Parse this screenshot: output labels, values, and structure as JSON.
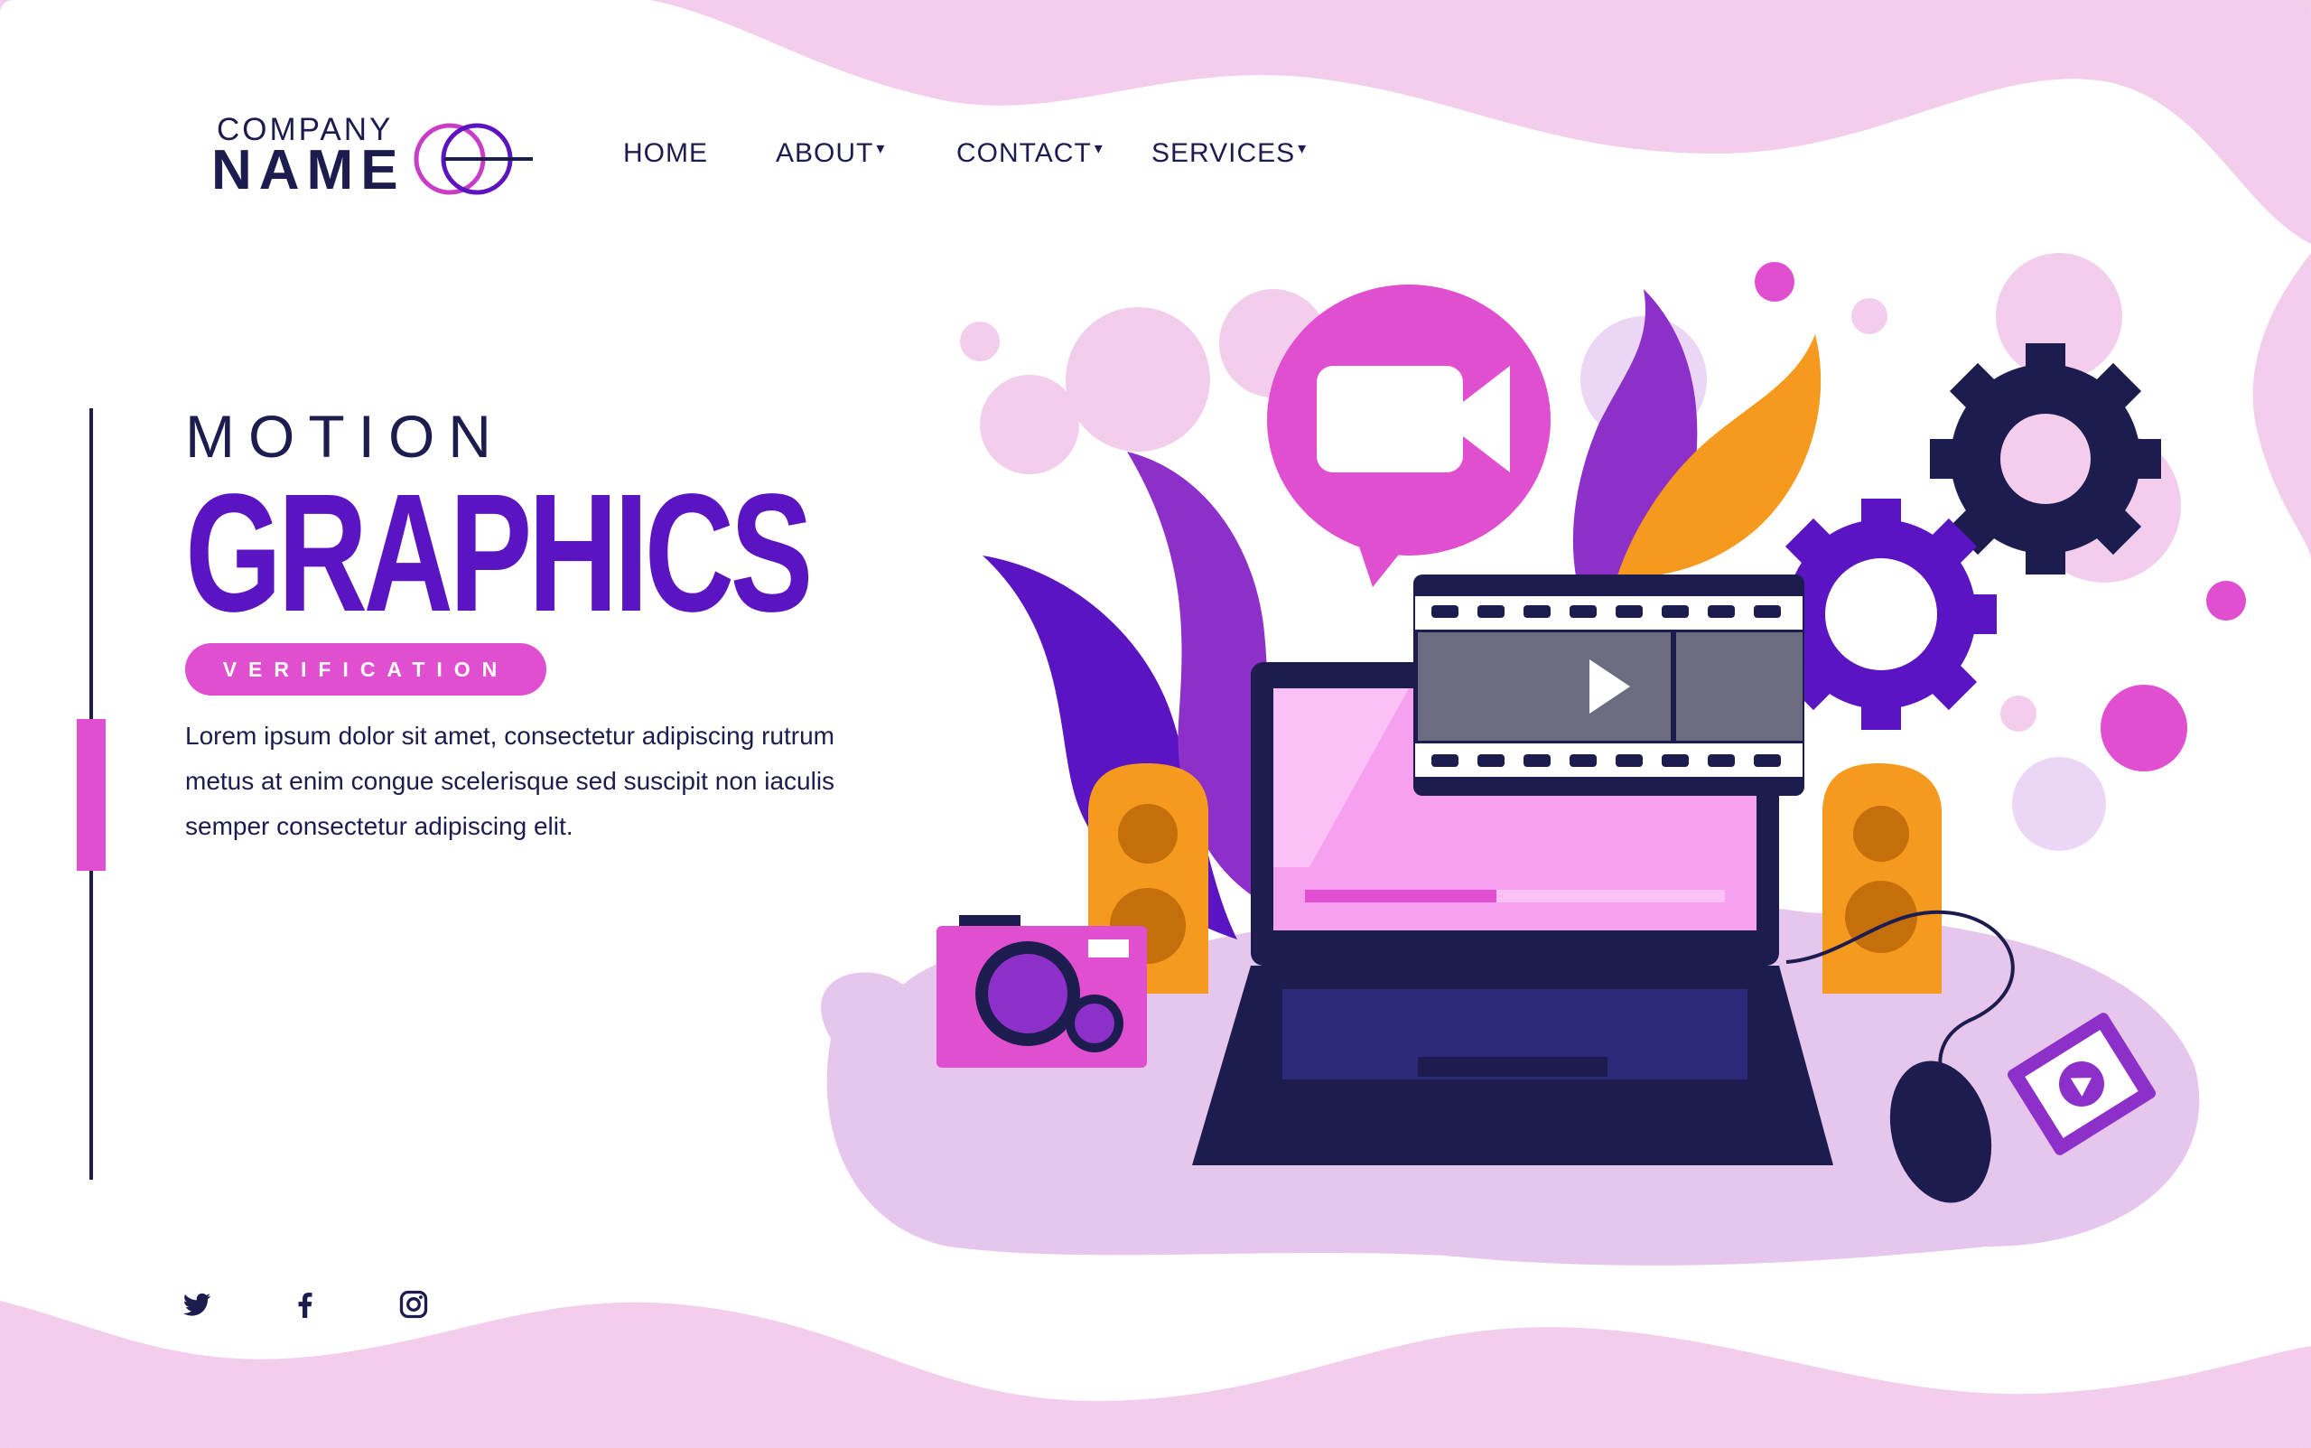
{
  "logo": {
    "line1": "COMPANY",
    "line2": "NAME",
    "mark_icon": "overlapping-circles-logo-icon"
  },
  "nav": [
    {
      "label": "HOME",
      "has_dropdown": false
    },
    {
      "label": "ABOUT",
      "has_dropdown": true
    },
    {
      "label": "CONTACT",
      "has_dropdown": true
    },
    {
      "label": "SERVICES",
      "has_dropdown": true
    }
  ],
  "dropdown_caret": "▾",
  "hero": {
    "kicker": "MOTION",
    "title": "GRAPHICS",
    "badge": "VERIFICATION",
    "body": "Lorem ipsum dolor sit amet, consectetur adipiscing rutrum metus at enim congue scelerisque sed suscipit non iaculis semper consectetur adipiscing elit."
  },
  "social": [
    {
      "icon": "twitter-icon"
    },
    {
      "icon": "facebook-icon"
    },
    {
      "icon": "instagram-icon"
    }
  ],
  "illustration": {
    "icons": [
      "video-camera-icon",
      "play-icon",
      "gear-icon",
      "laptop-icon",
      "camera-icon",
      "speaker-icon",
      "mouse-icon",
      "video-file-icon"
    ]
  },
  "colors": {
    "navy": "#1c1c4e",
    "purple": "#5a14c2",
    "magenta": "#e04fd0",
    "pink_light": "#f3cdec",
    "orange": "#f59a1e"
  }
}
